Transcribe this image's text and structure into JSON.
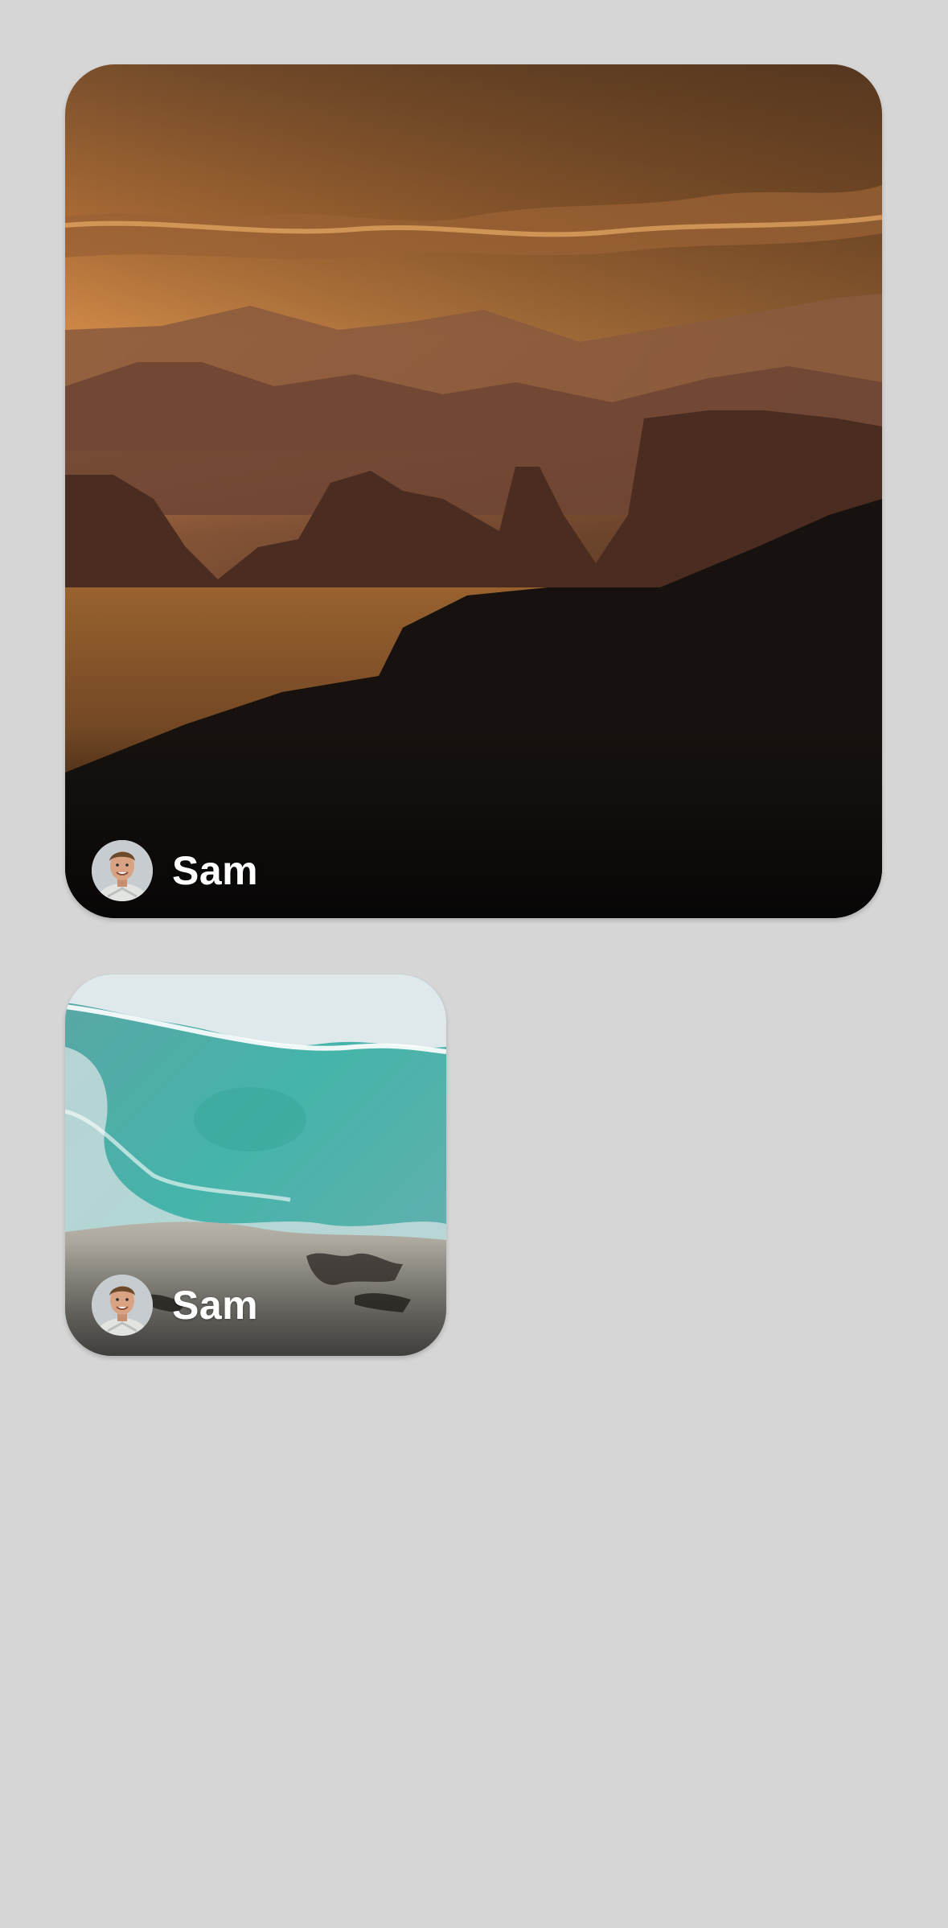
{
  "feed": {
    "posts": [
      {
        "scene_icon": "desert-sunset-photo",
        "author": {
          "name": "Sam",
          "avatar_icon": "person-avatar"
        }
      },
      {
        "scene_icon": "ocean-shore-photo",
        "author": {
          "name": "Sam",
          "avatar_icon": "person-avatar"
        }
      }
    ]
  },
  "colors": {
    "background": "#d6d6d6",
    "text": "#ffffff",
    "sunset_sky": "#c77a35",
    "ocean": "#4fb3ab"
  }
}
